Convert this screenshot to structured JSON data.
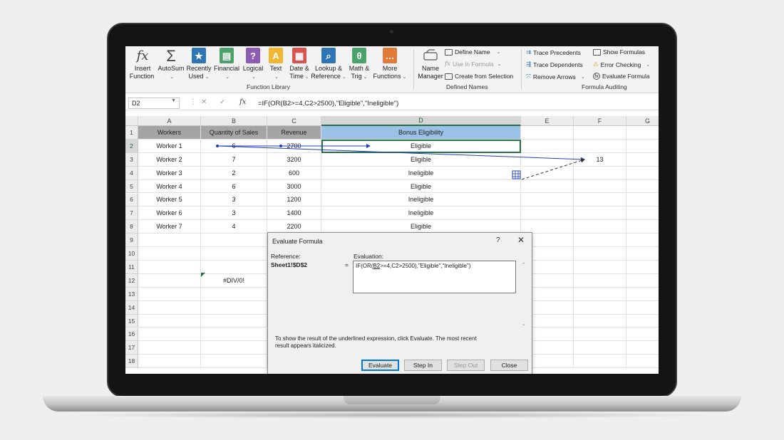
{
  "ribbon": {
    "function_library": {
      "label": "Function Library",
      "buttons": [
        {
          "line1": "Insert",
          "line2": "Function",
          "chev": "",
          "icon": "fx",
          "color": ""
        },
        {
          "line1": "AutoSum",
          "line2": "",
          "chev": "⌄",
          "icon": "Σ",
          "color": ""
        },
        {
          "line1": "Recently",
          "line2": "Used",
          "chev": "⌄",
          "icon": "★",
          "color": "#2e75b6"
        },
        {
          "line1": "Financial",
          "line2": "",
          "chev": "⌄",
          "icon": "▤",
          "color": "#4aa26a"
        },
        {
          "line1": "Logical",
          "line2": "",
          "chev": "⌄",
          "icon": "?",
          "color": "#8e5bb5"
        },
        {
          "line1": "Text",
          "line2": "",
          "chev": "⌄",
          "icon": "A",
          "color": "#f2b632"
        },
        {
          "line1": "Date &",
          "line2": "Time",
          "chev": "⌄",
          "icon": "▦",
          "color": "#d9534f"
        },
        {
          "line1": "Lookup &",
          "line2": "Reference",
          "chev": "⌄",
          "icon": "⌕",
          "color": "#2e75b6"
        },
        {
          "line1": "Math &",
          "line2": "Trig",
          "chev": "⌄",
          "icon": "θ",
          "color": "#4aa26a"
        },
        {
          "line1": "More",
          "line2": "Functions",
          "chev": "⌄",
          "icon": "…",
          "color": "#e07b39"
        }
      ]
    },
    "defined_names": {
      "label": "Defined Names",
      "name_manager_line1": "Name",
      "name_manager_line2": "Manager",
      "define_name": "Define Name",
      "use_in_formula": "Use in Formula",
      "create_from_selection": "Create from Selection"
    },
    "formula_auditing": {
      "label": "Formula Auditing",
      "trace_precedents": "Trace Precedents",
      "trace_dependents": "Trace Dependents",
      "remove_arrows": "Remove Arrows",
      "show_formulas": "Show Formulas",
      "error_checking": "Error Checking",
      "evaluate_formula": "Evaluate Formula"
    }
  },
  "formula_bar": {
    "name_box": "D2",
    "formula": "=IF(OR(B2>=4,C2>2500),\"Eligible\",\"Ineligible\")"
  },
  "sheet": {
    "columns": [
      "A",
      "B",
      "C",
      "D",
      "E",
      "F",
      "G"
    ],
    "rows": [
      "1",
      "2",
      "3",
      "4",
      "5",
      "6",
      "7",
      "8",
      "9",
      "10",
      "11",
      "12",
      "13",
      "14",
      "15",
      "16",
      "17",
      "18"
    ],
    "headers": [
      "Workers",
      "Quantity of Sales",
      "Revenue",
      "Bonus Eligibility"
    ],
    "data": [
      [
        "Worker 1",
        "6",
        "2700",
        "Eligible"
      ],
      [
        "Worker 2",
        "7",
        "3200",
        "Eligible"
      ],
      [
        "Worker 3",
        "2",
        "600",
        "Ineligible"
      ],
      [
        "Worker 4",
        "6",
        "3000",
        "Eligible"
      ],
      [
        "Worker 5",
        "3",
        "1200",
        "Ineligible"
      ],
      [
        "Worker 6",
        "3",
        "1400",
        "Ineligible"
      ],
      [
        "Worker 7",
        "4",
        "2200",
        "Eligible"
      ]
    ],
    "f3_value": "13",
    "b12_value": "#DIV/0!"
  },
  "dialog": {
    "title": "Evaluate Formula",
    "help": "?",
    "close": "✕",
    "reference_label": "Reference:",
    "reference_value": "Sheet1!$D$2",
    "evaluation_label": "Evaluation:",
    "equals": "=",
    "evaluation_before": "IF(OR(",
    "evaluation_underlined": "B2",
    "evaluation_after": ">=4,C2>2500),\"Eligible\",\"Ineligible\")",
    "hint": "To show the result of the underlined expression, click Evaluate.  The most recent result appears italicized.",
    "buttons": {
      "evaluate": "Evaluate",
      "step_in": "Step In",
      "step_out": "Step Out",
      "close": "Close"
    }
  },
  "colors": {
    "header_gray": "#a5a5a5",
    "header_blue": "#9bc2e6",
    "selection_green": "#217346",
    "trace_blue": "#1f3fbf"
  }
}
